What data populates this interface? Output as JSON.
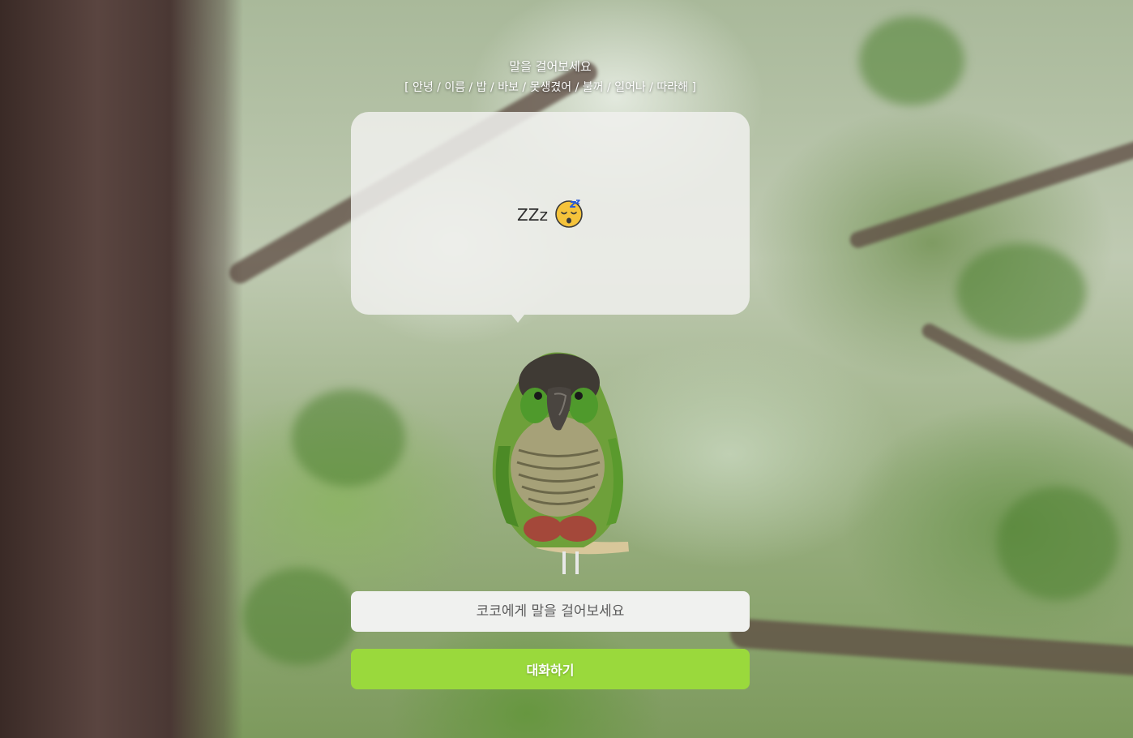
{
  "header": {
    "title": "말을 걸어보세요",
    "hint": "[ 안녕 / 이름 / 밥 / 바보 / 못생겼어 / 불꺼 / 일어나 / 따라해 ]"
  },
  "bubble": {
    "text": "ZZz",
    "icon": "sleeping-face-icon"
  },
  "parrot": {
    "icon": "parrot"
  },
  "chat": {
    "placeholder": "코코에게 말을 걸어보세요",
    "button_label": "대화하기"
  },
  "colors": {
    "button": "#9ad93c",
    "input_bg": "#f0f1ef",
    "bubble_bg": "#f0f0ee"
  }
}
